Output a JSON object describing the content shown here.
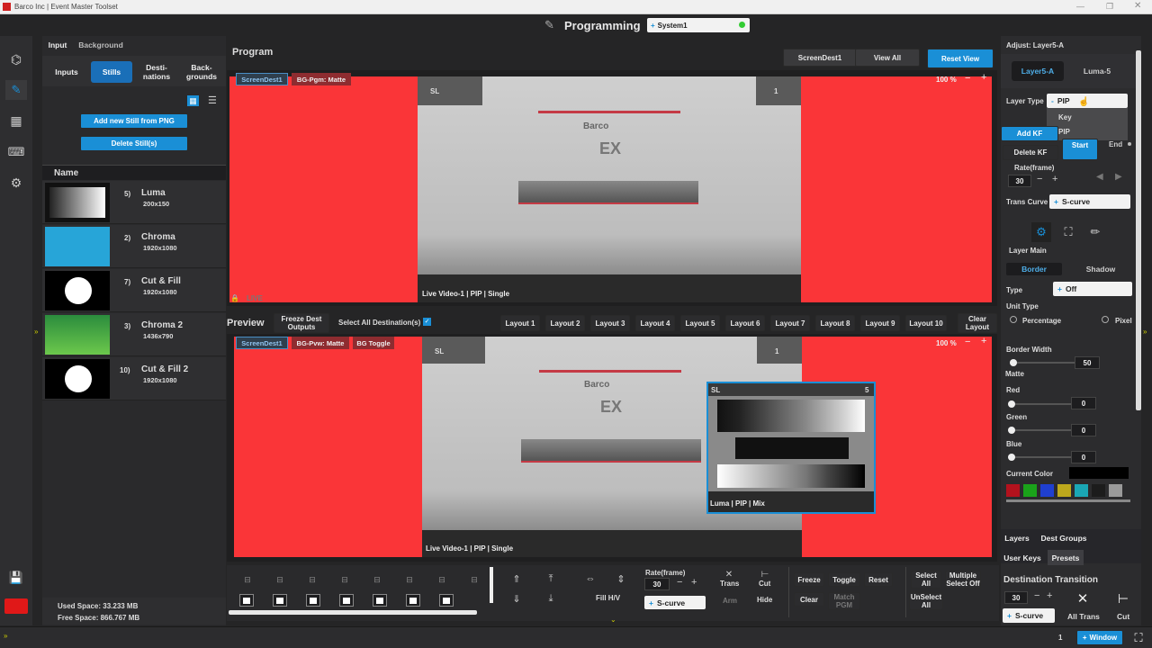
{
  "titlebar": {
    "app_title": "Barco Inc | Event Master Toolset"
  },
  "header": {
    "title": "Programming",
    "system": "System1"
  },
  "left_panel": {
    "tabs": [
      "Input",
      "Background"
    ],
    "subtabs": [
      "Inputs",
      "Stills",
      "Desti-\nnations",
      "Back-\ngrounds"
    ],
    "add_still": "Add new Still from PNG",
    "delete_still": "Delete Still(s)",
    "list_header": "Name",
    "stills": [
      {
        "num": "5)",
        "name": "Luma",
        "res": "200x150"
      },
      {
        "num": "2)",
        "name": "Chroma",
        "res": "1920x1080"
      },
      {
        "num": "7)",
        "name": "Cut & Fill",
        "res": "1920x1080"
      },
      {
        "num": "3)",
        "name": "Chroma 2",
        "res": "1436x790"
      },
      {
        "num": "10)",
        "name": "Cut & Fill 2",
        "res": "1920x1080"
      }
    ],
    "used_space": "Used Space: 33.233 MB",
    "free_space": "Free Space: 866.767 MB"
  },
  "program": {
    "title": "Program",
    "screen_dest_btn": "ScreenDest1",
    "view_all": "View All",
    "reset_view": "Reset View",
    "dest_tag": "ScreenDest1",
    "bg_tag": "BG-Pgm: Matte",
    "zoom": "100 %",
    "layer_sl": "SL",
    "layer_num": "1",
    "caption": "Live Video-1 | PIP | Single",
    "live_tag": "LIVE"
  },
  "preview": {
    "title": "Preview",
    "freeze": "Freeze Dest\nOutputs",
    "select_all": "Select All Destination(s)",
    "layouts": [
      "Layout 1",
      "Layout 2",
      "Layout 3",
      "Layout 4",
      "Layout 5",
      "Layout 6",
      "Layout 7",
      "Layout 8",
      "Layout 9",
      "Layout 10"
    ],
    "clear_layout": "Clear\nLayout",
    "dest_tag": "ScreenDest1",
    "bg_tag": "BG-Pvw: Matte",
    "bg_toggle": "BG Toggle",
    "zoom": "100 %",
    "layer_sl": "SL",
    "layer_num": "1",
    "caption": "Live Video-1 | PIP | Single",
    "pip_sl": "SL",
    "pip_num": "5",
    "pip_caption": "Luma | PIP | Mix"
  },
  "content_text": {
    "brand": "Barco",
    "logo": "EX"
  },
  "bottom_toolbar": {
    "fill": "Fill H/V",
    "rate_label": "Rate(frame)",
    "rate_value": "30",
    "curve": "S-curve",
    "trans": "Trans",
    "arm": "Arm",
    "cut": "Cut",
    "hide": "Hide",
    "freeze": "Freeze",
    "clear": "Clear",
    "toggle": "Toggle",
    "match_pgm": "Match\nPGM",
    "reset": "Reset",
    "select_all": "Select\nAll",
    "unselect_all": "UnSelect\nAll",
    "multiple_select_off": "Multiple\nSelect Off"
  },
  "right_panel": {
    "adjust_title": "Adjust: Layer5-A",
    "tab_layer": "Layer5-A",
    "tab_luma": "Luma-5",
    "layer_type_label": "Layer Type",
    "layer_type_value": "PIP",
    "dropdown_options": [
      "Key",
      "PIP"
    ],
    "add_kf": "Add KF",
    "delete_kf": "Delete KF",
    "start": "Start",
    "end": "End",
    "rate_label": "Rate(frame)",
    "rate_value": "30",
    "trans_curve_label": "Trans Curve",
    "trans_curve_value": "S-curve",
    "layer_main": "Layer Main",
    "border_tab": "Border",
    "shadow_tab": "Shadow",
    "type_label": "Type",
    "type_value": "Off",
    "unit_type": "Unit Type",
    "percentage": "Percentage",
    "pixel": "Pixel",
    "border_width_label": "Border Width",
    "border_width_value": "50",
    "matte": "Matte",
    "red_label": "Red",
    "red_value": "0",
    "green_label": "Green",
    "green_value": "0",
    "blue_label": "Blue",
    "blue_value": "0",
    "current_color": "Current Color",
    "palette": [
      "#b3121d",
      "#1aa31a",
      "#1f3fd0",
      "#bda81c",
      "#1aa7b5",
      "#1c1c1c",
      "#9a9a9a"
    ],
    "tab_layers": "Layers",
    "tab_dest_groups": "Dest Groups",
    "tab_user_keys": "User Keys",
    "tab_presets": "Presets",
    "dest_transition": "Destination Transition",
    "dt_rate": "30",
    "dt_curve": "S-curve",
    "all_trans": "All Trans",
    "cut": "Cut"
  },
  "statusbar": {
    "page": "1",
    "window_btn": "Window"
  },
  "colors": {
    "accent": "#1a8fd6",
    "matte": "#fa3538"
  }
}
